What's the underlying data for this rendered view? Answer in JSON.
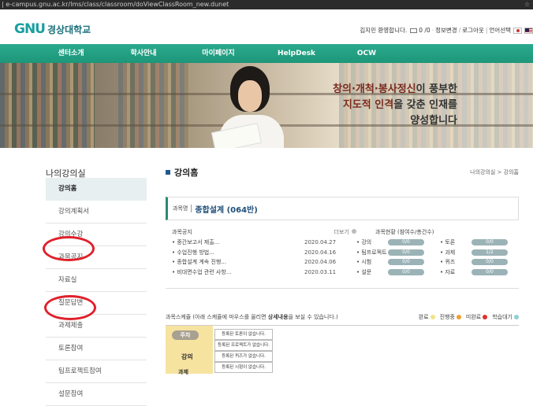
{
  "url": "| e-campus.gnu.ac.kr/lms/class/classroom/doViewClassRoom_new.dunet",
  "header": {
    "logo_mark": "GNU",
    "logo_text": "경상대학교",
    "user_greeting": "김지민 환영합니다.",
    "mail_count": "0 /0",
    "info_link": "정보변경",
    "logout_link": "로그아웃",
    "lang_label": "언어선택"
  },
  "nav": [
    "센터소개",
    "학사안내",
    "마이페이지",
    "HelpDesk",
    "OCW"
  ],
  "banner": {
    "line1_hl": "창의·개척·봉사정신",
    "line1_rest": "이 풍부한",
    "line2_hl": "지도적 인격",
    "line2_rest": "을 갖춘 인재를",
    "line3": "양성합니다"
  },
  "sidebar": {
    "title": "나의강의실",
    "items": [
      "강의홈",
      "강의계획서",
      "강의수강",
      "과목공지",
      "자료실",
      "질문답변",
      "과제제출",
      "토론참여",
      "팀프로젝트참여",
      "설문참여"
    ]
  },
  "content": {
    "title": "강의홈",
    "breadcrumb": "나의강의실 > 강의홈",
    "course_label": "과목명",
    "course_name": "종합설계 (064반)",
    "notice_title": "과목공지",
    "more": "더보기",
    "status_title": "과목현황 (참여수/총건수)",
    "notices": [
      {
        "title": "중간보고서 제출...",
        "date": "2020.04.27"
      },
      {
        "title": "수업진행 방법...",
        "date": "2020.04.16"
      },
      {
        "title": "종합설계 계속 진행...",
        "date": "2020.04.06"
      },
      {
        "title": "비대면수업 관련 사항...",
        "date": "2020.03.11"
      }
    ],
    "status_left": [
      {
        "label": "강의",
        "value": "0/0"
      },
      {
        "label": "팀프로젝트",
        "value": "0/0"
      },
      {
        "label": "시험",
        "value": "0/0"
      },
      {
        "label": "설문",
        "value": "0/0"
      }
    ],
    "status_right": [
      {
        "label": "토론",
        "value": "0/0"
      },
      {
        "label": "과제",
        "value": "1/2"
      },
      {
        "label": "퀴즈",
        "value": "0/0"
      },
      {
        "label": "자료",
        "value": "0/0"
      }
    ]
  },
  "schedule": {
    "intro": "과목스케쥴 (아래 스케쥴에 마우스를 올리면 ",
    "intro_bold": "상세내용",
    "intro_end": "을 보실 수 있습니다.)",
    "legend": [
      {
        "label": "완료",
        "color": "#f2e28a"
      },
      {
        "label": "진행중",
        "color": "#f0a030"
      },
      {
        "label": "미완료",
        "color": "#e0302a"
      },
      {
        "label": "학습대기",
        "color": "#8fd0d0"
      }
    ],
    "week_label": "주차",
    "lecture_label": "강의",
    "lecture_label2": "과제",
    "cells": [
      "등록된 토론이 없습니다.",
      "등록된 프로젝트가 없습니다.",
      "등록된 퀴즈가 없습니다.",
      "등록된 시험이 없습니다."
    ]
  }
}
